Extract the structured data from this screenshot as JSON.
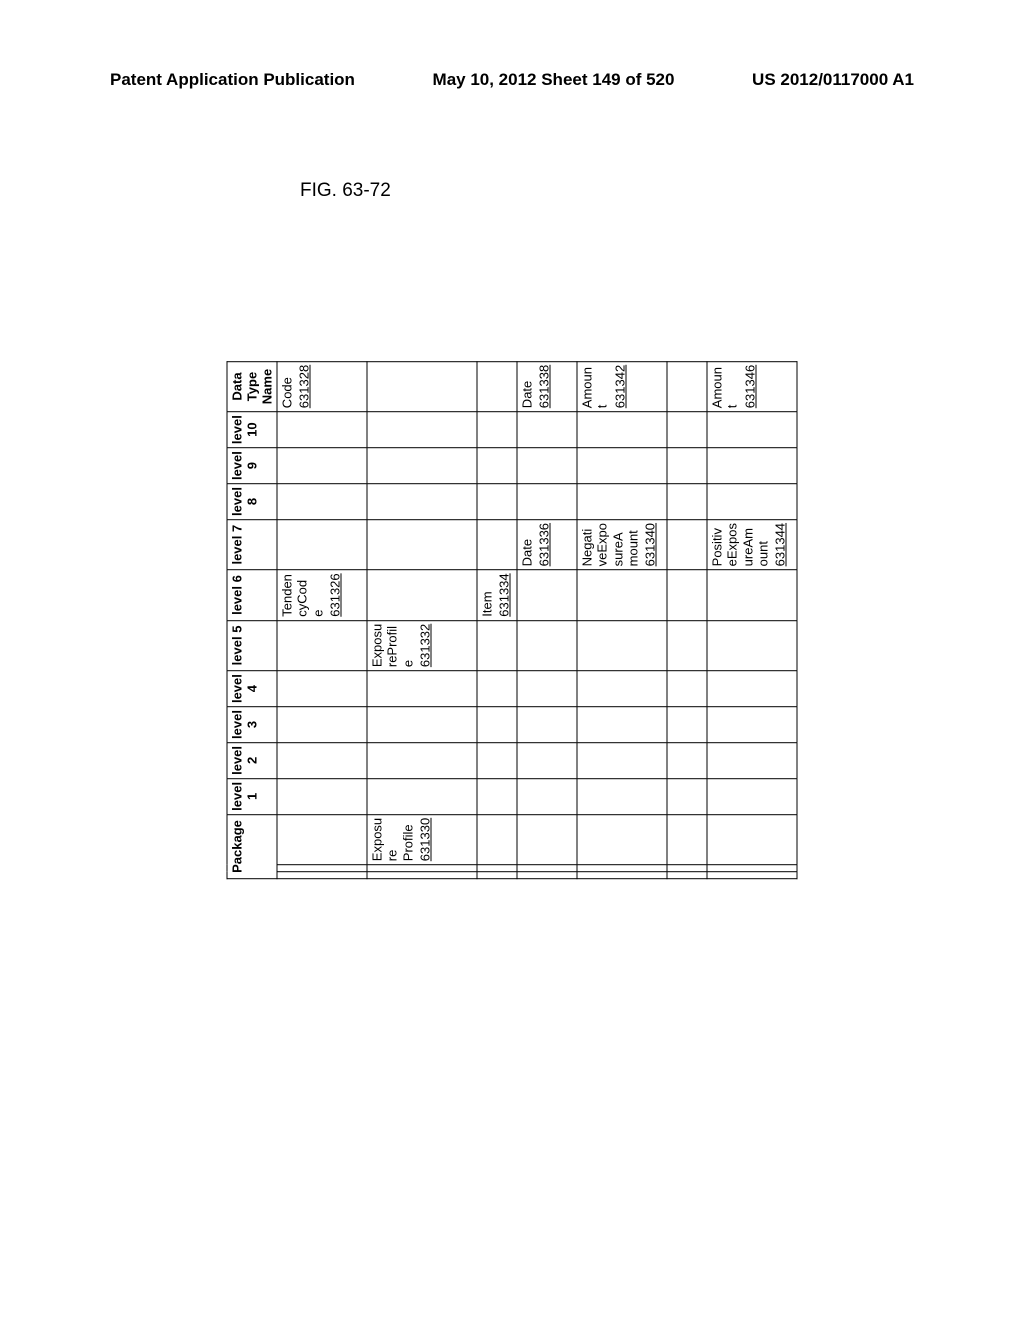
{
  "header": {
    "left": "Patent Application Publication",
    "mid": "May 10, 2012  Sheet 149 of 520",
    "right": "US 2012/0117000 A1"
  },
  "figure_label": "FIG. 63-72",
  "columns": {
    "package": "Package",
    "levels": [
      "level 1",
      "level 2",
      "level 3",
      "level 4",
      "level 5",
      "level 6",
      "level 7",
      "level 8",
      "level 9",
      "level 10"
    ],
    "data_type_name": "Data Type Name"
  },
  "rows": [
    {
      "height": "tall",
      "cells": {
        "level 6": {
          "name": "TendencyCode",
          "ref": "631326"
        },
        "data_type": {
          "name": "Code",
          "ref": "631328"
        }
      }
    },
    {
      "height": "xtall",
      "cells": {
        "package_c": {
          "name": "Exposure Profile",
          "ref": "631330"
        },
        "level 5": {
          "name": "ExposureProfile",
          "ref": "631332"
        }
      }
    },
    {
      "height": "short",
      "cells": {
        "level 6": {
          "name": "Item",
          "ref": "631334"
        }
      }
    },
    {
      "height": "med",
      "cells": {
        "level 7": {
          "name": "Date",
          "ref": "631336"
        },
        "data_type": {
          "name": "Date",
          "ref": "631338"
        }
      }
    },
    {
      "height": "tall",
      "cells": {
        "level 7": {
          "name": "NegativeExposureAmount",
          "ref": "631340"
        },
        "data_type": {
          "name": "Amount",
          "ref": "631342"
        }
      }
    },
    {
      "height": "short",
      "cells": {}
    },
    {
      "height": "tall",
      "cells": {
        "level 7": {
          "name": "PositiveExposureAmount",
          "ref": "631344"
        },
        "data_type": {
          "name": "Amount",
          "ref": "631346"
        }
      }
    }
  ]
}
